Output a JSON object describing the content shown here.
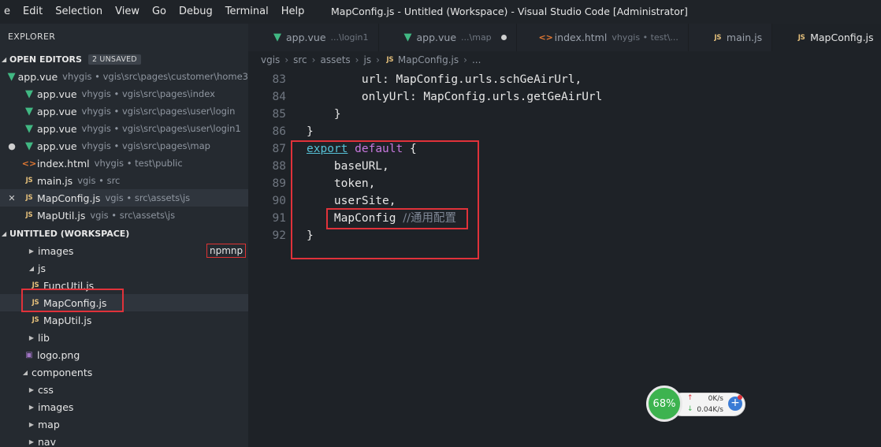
{
  "menu": [
    "e",
    "Edit",
    "Selection",
    "View",
    "Go",
    "Debug",
    "Terminal",
    "Help"
  ],
  "window_title": "MapConfig.js - Untitled (Workspace) - Visual Studio Code [Administrator]",
  "sidebar": {
    "title": "EXPLORER",
    "open_editors": {
      "label": "OPEN EDITORS",
      "badge": "2 UNSAVED",
      "items": [
        {
          "icon": "vue-icon",
          "name": "app.vue",
          "desc": "vhygis • vgis\\src\\pages\\customer\\home3",
          "lead": ""
        },
        {
          "icon": "vue-icon",
          "name": "app.vue",
          "desc": "vhygis • vgis\\src\\pages\\index",
          "lead": ""
        },
        {
          "icon": "vue-icon",
          "name": "app.vue",
          "desc": "vhygis • vgis\\src\\pages\\user\\login",
          "lead": ""
        },
        {
          "icon": "vue-icon",
          "name": "app.vue",
          "desc": "vhygis • vgis\\src\\pages\\user\\login1",
          "lead": ""
        },
        {
          "icon": "vue-icon",
          "name": "app.vue",
          "desc": "vhygis • vgis\\src\\pages\\map",
          "lead": "●"
        },
        {
          "icon": "html-icon",
          "name": "index.html",
          "desc": "vhygis • test\\public",
          "lead": ""
        },
        {
          "icon": "js-icon",
          "name": "main.js",
          "desc": "vgis • src",
          "lead": ""
        },
        {
          "icon": "js-icon",
          "name": "MapConfig.js",
          "desc": "vgis • src\\assets\\js",
          "lead": "✕"
        },
        {
          "icon": "js-icon",
          "name": "MapUtil.js",
          "desc": "vgis • src\\assets\\js",
          "lead": ""
        }
      ]
    },
    "workspace": {
      "label": "UNTITLED (WORKSPACE)",
      "badge_label": "npmnp",
      "tree": [
        {
          "type": "folder",
          "name": "images",
          "open": false,
          "indent": 34
        },
        {
          "type": "folder",
          "name": "js",
          "open": true,
          "indent": 34
        },
        {
          "type": "js",
          "name": "FuncUtil.js",
          "indent": 38
        },
        {
          "type": "js",
          "name": "MapConfig.js",
          "indent": 38
        },
        {
          "type": "js",
          "name": "MapUtil.js",
          "indent": 38
        },
        {
          "type": "folder",
          "name": "lib",
          "open": false,
          "indent": 34
        },
        {
          "type": "png",
          "name": "logo.png",
          "indent": 30
        },
        {
          "type": "folder",
          "name": "components",
          "open": true,
          "indent": 26
        },
        {
          "type": "folder",
          "name": "css",
          "open": false,
          "indent": 34
        },
        {
          "type": "folder",
          "name": "images",
          "open": false,
          "indent": 34
        },
        {
          "type": "folder",
          "name": "map",
          "open": false,
          "indent": 34
        },
        {
          "type": "folder",
          "name": "nav",
          "open": false,
          "indent": 34
        }
      ]
    }
  },
  "tabs": [
    {
      "icon": "vue-icon",
      "name": "app.vue",
      "desc": "...\\login1",
      "dirty": false,
      "active": false
    },
    {
      "icon": "vue-icon",
      "name": "app.vue",
      "desc": "...\\map",
      "dirty": true,
      "active": false
    },
    {
      "icon": "html-icon",
      "name": "index.html",
      "desc": "vhygis • test\\...",
      "dirty": false,
      "active": false
    },
    {
      "icon": "js-icon",
      "name": "main.js",
      "desc": "",
      "dirty": false,
      "active": false
    },
    {
      "icon": "js-icon",
      "name": "MapConfig.js",
      "desc": "",
      "dirty": false,
      "active": true
    }
  ],
  "breadcrumb": [
    "vgis",
    "src",
    "assets",
    "js",
    "MapConfig.js",
    "..."
  ],
  "icon_glyphs": {
    "vue": "▼",
    "js": "JS",
    "html": "<>",
    "png": "▣",
    "close": "✕",
    "dot": "●",
    "arrow_closed": "▶",
    "arrow_open": "◢",
    "up": "↑",
    "down": "↓",
    "plus": "+"
  },
  "code_lines": [
    {
      "n": "83",
      "tokens": [
        {
          "t": "        url: MapConfig.urls.schGeAirUrl,",
          "c": "prop"
        }
      ]
    },
    {
      "n": "84",
      "tokens": [
        {
          "t": "        onlyUrl: MapConfig.urls.getGeAirUrl",
          "c": "prop"
        }
      ]
    },
    {
      "n": "85",
      "tokens": [
        {
          "t": "    }",
          "c": "prop"
        }
      ]
    },
    {
      "n": "86",
      "tokens": [
        {
          "t": "}",
          "c": "prop"
        }
      ]
    },
    {
      "n": "87",
      "tokens": [
        {
          "t": "export",
          "c": "kw-export"
        },
        {
          "t": " ",
          "c": "prop"
        },
        {
          "t": "default",
          "c": "kw"
        },
        {
          "t": " {",
          "c": "prop"
        }
      ]
    },
    {
      "n": "88",
      "tokens": [
        {
          "t": "    baseURL,",
          "c": "prop"
        }
      ]
    },
    {
      "n": "89",
      "tokens": [
        {
          "t": "    token,",
          "c": "prop"
        }
      ]
    },
    {
      "n": "90",
      "tokens": [
        {
          "t": "    userSite,",
          "c": "prop"
        }
      ]
    },
    {
      "n": "91",
      "tokens": [
        {
          "t": "    MapConfig ",
          "c": "prop"
        },
        {
          "t": "//通用配置",
          "c": "comment"
        }
      ]
    },
    {
      "n": "92",
      "tokens": [
        {
          "t": "}",
          "c": "prop"
        }
      ]
    }
  ],
  "net_widget": {
    "percent": "68%",
    "up": "0K/s",
    "down": "0.04K/s"
  },
  "colors": {
    "accent_red": "#e0323a",
    "vue": "#41b883",
    "js": "#e5c07b"
  }
}
